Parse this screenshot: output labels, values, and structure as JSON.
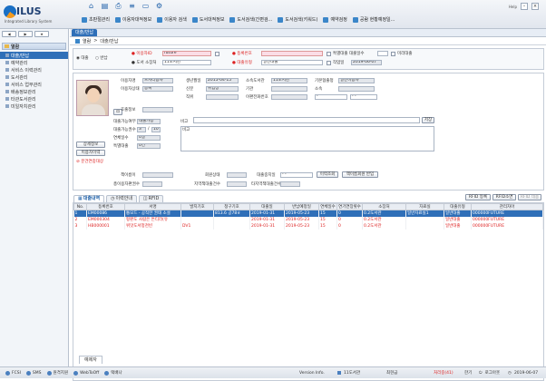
{
  "app": {
    "logo_name": "ILUS",
    "logo_sub": "Integrated Library System",
    "help": "Help"
  },
  "toolbar_icons": [
    "home-icon",
    "document-icon",
    "print-icon",
    "list-icon",
    "display-icon",
    "gear-icon"
  ],
  "toolbar": [
    "초판절관리",
    "이용자대적정보",
    "이용자 검색",
    "도서대적정보",
    "도서검색(간편검...",
    "도서검색(키워드)",
    "예약검정",
    "공람 현황예정일..."
  ],
  "sidebar": {
    "buttons": [
      "◀",
      "▶",
      "★"
    ],
    "header": "열람",
    "items": [
      "대출/반납",
      "예약관리",
      "서비스 이력관리",
      "도서관리",
      "서비스 업무관리",
      "배송정보관리",
      "타관도서관리",
      "미일자치관리"
    ]
  },
  "main": {
    "tab": "대출/반납",
    "breadcrumb": [
      "열람",
      "대출/반납"
    ],
    "mode": {
      "loan": "대출",
      "return": "반납"
    },
    "search": {
      "user_id_label": "이용자ID",
      "user_id": "future",
      "return_place_label": "도서 소장처",
      "return_place": "11도서관",
      "reg_label": "등록번호",
      "loan_type_label": "대출유형",
      "loan_type": "일반대출",
      "loan_days_label": "특별대출 대출일수",
      "loan_date_label": "작업일",
      "loan_date": "2019-06-07",
      "offline_label": "미리대출"
    },
    "user": {
      "name_label": "이용자명",
      "name": "프자티용자",
      "status_label": "이용자상태",
      "status": "등록",
      "birth_label": "생년월일",
      "birth": "2015-04-15",
      "class_label": "신분",
      "class": "위임상",
      "job_label": "직위",
      "org_label": "소속도서관",
      "org": "11도서관",
      "institution_label": "기관",
      "base_label": "기본협출청",
      "base": "일반이용자",
      "dept_label": "소속",
      "phone_label": "이편전화번호",
      "etc_label": "이메일",
      "pager_label": "호출정보",
      "loan_ok_label": "대출가능여부",
      "loan_ok": "대출가능",
      "loan_count_label": "대출가능권수",
      "loan_count_cur": "3",
      "loan_count_max": "10",
      "overdue_label": "연체일수",
      "overdue": "0일",
      "special_label": "특별대출",
      "special": "0건",
      "memo_label": "비고",
      "memo": "비고",
      "memo_save": "저장",
      "btn_detail": "상세정보",
      "btn_history": "이용자이력",
      "btn_warn": "분건연중대상"
    },
    "row3": {
      "book_label": "책이름이",
      "member_label": "회원상태",
      "loan_stop_label": "대출중지일",
      "loan_stop": "- -",
      "btn_search": "이력조회",
      "btn_reset": "책이름회원 반입",
      "total_label": "총이용자편권수",
      "region_label": "지역책대출건수",
      "region2_label": "타지역책대출건수"
    },
    "tabs": [
      "대출내역",
      "이력안내",
      "RFID"
    ],
    "rfid_btns": [
      "RFID 등록",
      "RFID소면",
      "RFID 테용"
    ],
    "table": {
      "headers": [
        "No.",
        "등록번호",
        "서명",
        "발지기호",
        "청구기호",
        "대출일",
        "반납예정일",
        "연체일수",
        "연기연장횟수",
        "소장처",
        "자료실",
        "대출유형",
        "관리자아"
      ],
      "rows": [
        {
          "no": "1",
          "reg": "EM00086",
          "title": "통모드 - 공직한 권태 소설",
          "cls": "",
          "call": "813.6 공78ㅎ",
          "loan": "2019-01-31",
          "due": "2019-05-23",
          "over": "15",
          "ext": "0",
          "place": "0.2도서관",
          "room": "일반자료실1",
          "type": "일반대출",
          "mgr": "000000FUTURE"
        },
        {
          "no": "2",
          "reg": "EM000304",
          "title": "펑판도 사람은 튼티라(유",
          "cls": "",
          "call": "",
          "loan": "2019-01-31",
          "due": "2019-05-23",
          "over": "15",
          "ext": "0",
          "place": "0.2도서관",
          "room": "",
          "type": "일반대출",
          "mgr": "000000FUTURE"
        },
        {
          "no": "3",
          "reg": "HB000001",
          "title": "위맛도서청천빈",
          "cls": "DV1",
          "call": "",
          "loan": "2019-01-31",
          "due": "2019-05-23",
          "over": "15",
          "ext": "0",
          "place": "0.2도서관",
          "room": "",
          "type": "일반대출",
          "mgr": "000000FUTURE"
        }
      ]
    },
    "bottom_tab": "예제자"
  },
  "statusbar": {
    "items": [
      "FCSI",
      "SMS",
      "원격지원",
      "WebToOff",
      "택배나"
    ],
    "version": "Version Info.",
    "lib": "11도서관",
    "user": "최현금",
    "alert": "처리중(41)",
    "lang": "한기",
    "logout": "로그아웃",
    "date": "2019-06-07"
  }
}
